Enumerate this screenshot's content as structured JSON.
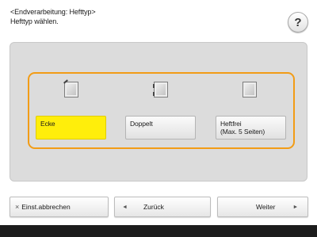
{
  "header": {
    "line1": "<Endverarbeitung: Hefttyp>",
    "line2": "Hefttyp wählen.",
    "help_label": "?"
  },
  "options": [
    {
      "label_line1": "Ecke",
      "label_line2": "",
      "selected": true,
      "icon": "staple-corner-icon"
    },
    {
      "label_line1": "Doppelt",
      "label_line2": "",
      "selected": false,
      "icon": "staple-double-icon"
    },
    {
      "label_line1": "Heftfrei",
      "label_line2": "(Max. 5 Seiten)",
      "selected": false,
      "icon": "staple-free-icon"
    }
  ],
  "footer": {
    "cancel_label": "Einst.abbrechen",
    "back_label": "Zurück",
    "next_label": "Weiter",
    "cancel_icon": "×",
    "back_icon": "◄",
    "next_icon": "►"
  },
  "colors": {
    "selected": "#ffee0b",
    "selection_border": "#f29c16",
    "panel": "#dcdcdc"
  }
}
